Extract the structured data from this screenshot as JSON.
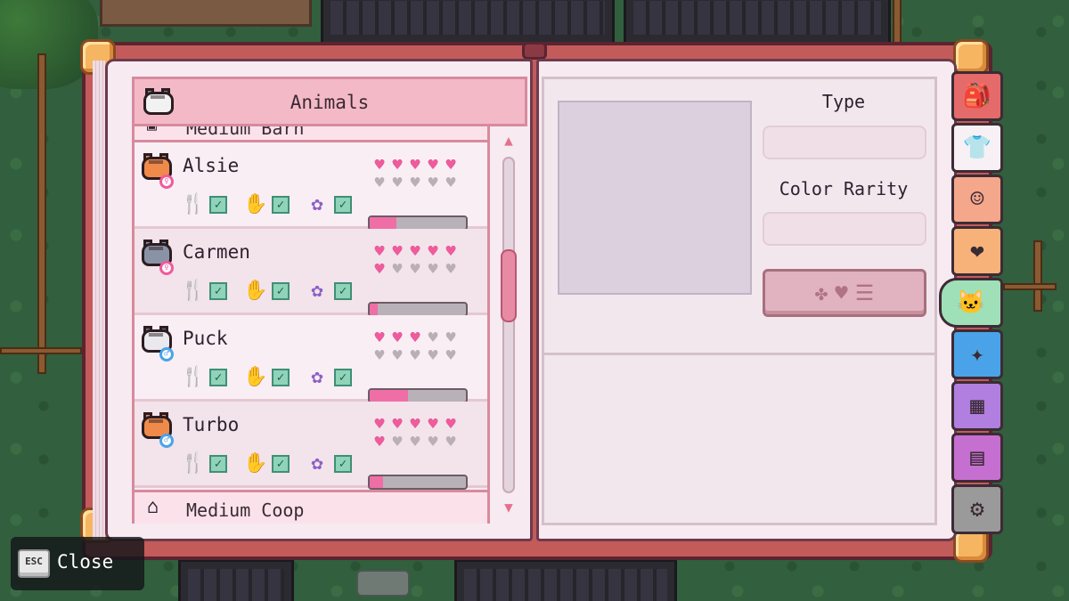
{
  "book": {
    "left_page": {
      "header_title": "Animals",
      "header_icon": "cat-face-icon",
      "groups": [
        {
          "label": "Medium Barn",
          "icon": "barn-icon"
        },
        {
          "label": "Medium Coop",
          "icon": "coop-icon"
        }
      ],
      "animals": [
        {
          "name": "Alsie",
          "fur": "orange-tabby",
          "gender": "female",
          "hearts_filled": 5,
          "hearts_total": 10,
          "fed": true,
          "watered": true,
          "petted": true,
          "friendship_progress": 0.28
        },
        {
          "name": "Carmen",
          "fur": "gray-tabby",
          "gender": "female",
          "hearts_filled": 6,
          "hearts_total": 10,
          "fed": true,
          "watered": true,
          "petted": true,
          "friendship_progress": 0.08
        },
        {
          "name": "Puck",
          "fur": "white-gray",
          "gender": "male",
          "hearts_filled": 3,
          "hearts_total": 10,
          "fed": true,
          "watered": true,
          "petted": true,
          "friendship_progress": 0.4
        },
        {
          "name": "Turbo",
          "fur": "orange-tabby",
          "gender": "male",
          "hearts_filled": 6,
          "hearts_total": 10,
          "fed": true,
          "watered": true,
          "petted": true,
          "friendship_progress": 0.14
        }
      ],
      "need_icons": [
        "food-icon",
        "hand-icon",
        "pet-icon"
      ]
    },
    "right_page": {
      "type_label": "Type",
      "type_value": "",
      "color_rarity_label": "Color Rarity",
      "color_rarity_value": "",
      "action_button_icon": "bone-heart-list-icon"
    }
  },
  "side_tabs": [
    {
      "icon": "backpack-icon",
      "color": "#e56b6b",
      "glyph": "🎒",
      "active": false
    },
    {
      "icon": "clothing-icon",
      "color": "#f7f0f4",
      "glyph": "👕",
      "active": false
    },
    {
      "icon": "character-icon",
      "color": "#f4a78a",
      "glyph": "☺",
      "active": false
    },
    {
      "icon": "heart-icon",
      "color": "#f7b27a",
      "glyph": "❤",
      "active": false
    },
    {
      "icon": "animal-icon",
      "color": "#9fe0b8",
      "glyph": "🐱",
      "active": true
    },
    {
      "icon": "sparkle-icon",
      "color": "#4aa3e8",
      "glyph": "✦",
      "active": false
    },
    {
      "icon": "map-icon",
      "color": "#b07fe0",
      "glyph": "▦",
      "active": false
    },
    {
      "icon": "journal-icon",
      "color": "#c56fd0",
      "glyph": "▤",
      "active": false
    },
    {
      "icon": "settings-gear-icon",
      "color": "#9a9a9a",
      "glyph": "⚙",
      "active": false
    }
  ],
  "hint": {
    "key_label": "ESC",
    "action_label": "Close"
  },
  "colors": {
    "heart_on": "#ef5b9c",
    "heart_off": "#b9afb5",
    "progress_fill": "#ef6ea6",
    "header_pink": "#f4b9c7",
    "book_cover": "#c45b5b"
  }
}
